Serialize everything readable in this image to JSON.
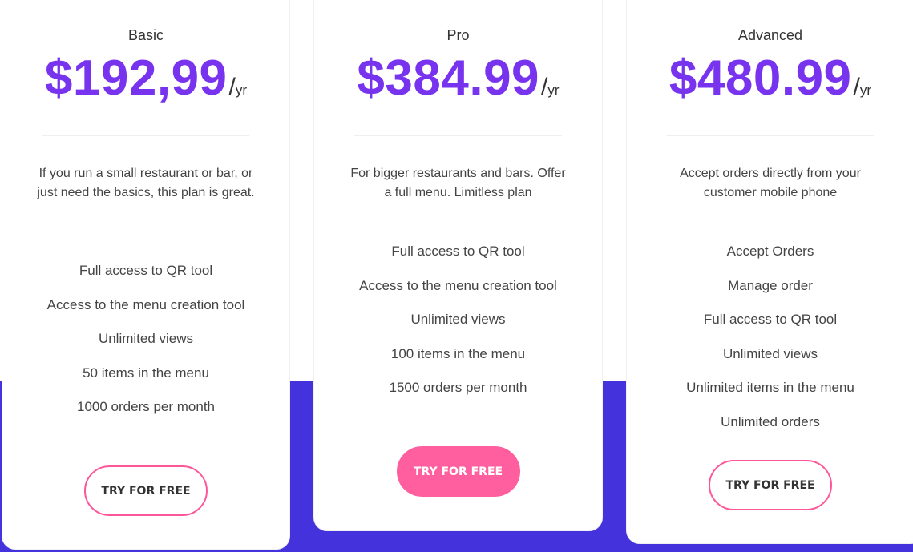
{
  "colors": {
    "accent": "#7733ee",
    "band": "#4433dd",
    "button": "#ff5f9e"
  },
  "plans": [
    {
      "name": "Basic",
      "price": "$192,99",
      "period_slash": "/",
      "period": "yr",
      "description": "If you run a small restaurant or bar, or just need the basics, this plan is great.",
      "features": [
        "Full access to QR tool",
        "Access to the menu creation tool",
        "Unlimited views",
        "50 items in the menu",
        "1000 orders per month"
      ],
      "button": "TRY FOR FREE"
    },
    {
      "name": "Pro",
      "price": "$384.99",
      "period_slash": "/",
      "period": "yr",
      "description": "For bigger restaurants and bars. Offer a full menu. Limitless plan",
      "features": [
        "Full access to QR tool",
        "Access to the menu creation tool",
        "Unlimited views",
        "100 items in the menu",
        "1500 orders per month"
      ],
      "button": "TRY FOR FREE"
    },
    {
      "name": "Advanced",
      "price": "$480.99",
      "period_slash": "/",
      "period": "yr",
      "description": "Accept orders directly from your customer mobile phone",
      "features": [
        "Accept Orders",
        "Manage order",
        "Full access to QR tool",
        "Unlimited views",
        "Unlimited items in the menu",
        "Unlimited orders"
      ],
      "button": "TRY FOR FREE"
    }
  ]
}
